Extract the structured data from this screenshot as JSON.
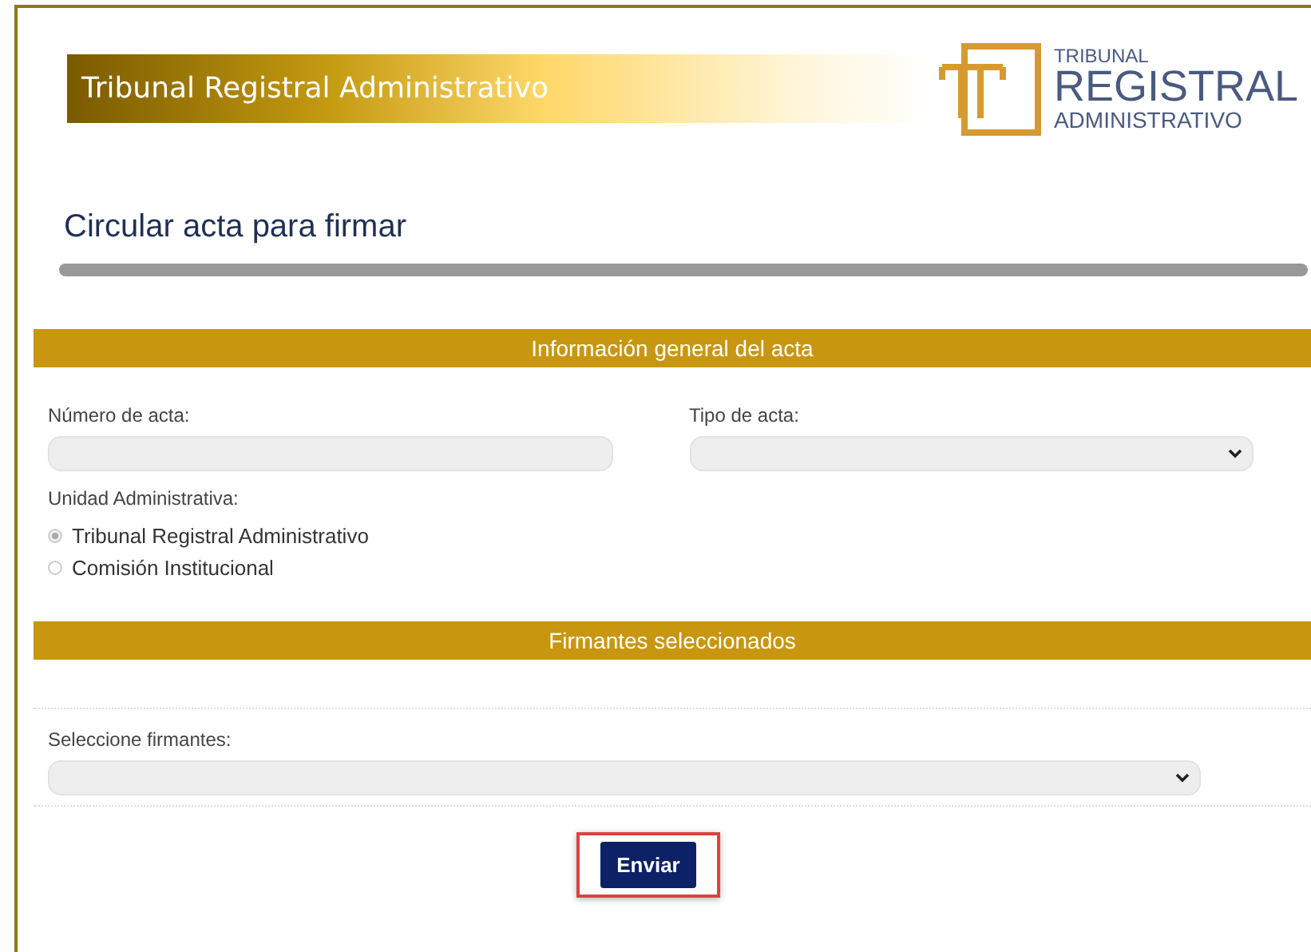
{
  "banner": {
    "title": "Tribunal Registral Administrativo"
  },
  "logo": {
    "line_1": "TRIBUNAL",
    "line_2": "REGISTRAL",
    "line_3": "ADMINISTRATIVO"
  },
  "page_title": "Circular acta para firmar",
  "sections": [
    {
      "title": "Información general del acta"
    },
    {
      "title": "Firmantes seleccionados"
    }
  ],
  "fields": [
    {
      "label": "Número de acta:",
      "kind": "text"
    },
    {
      "label": "Tipo de acta:",
      "kind": "select"
    }
  ],
  "unit": {
    "label": "Unidad Administrativa:",
    "options": [
      {
        "label": "Tribunal Registral Administrativo",
        "selected": true
      },
      {
        "label": "Comisión Institucional",
        "selected": false
      }
    ]
  },
  "signers": {
    "label": "Seleccione firmantes:"
  },
  "submit": {
    "label": "Enviar",
    "highlighted": true
  }
}
